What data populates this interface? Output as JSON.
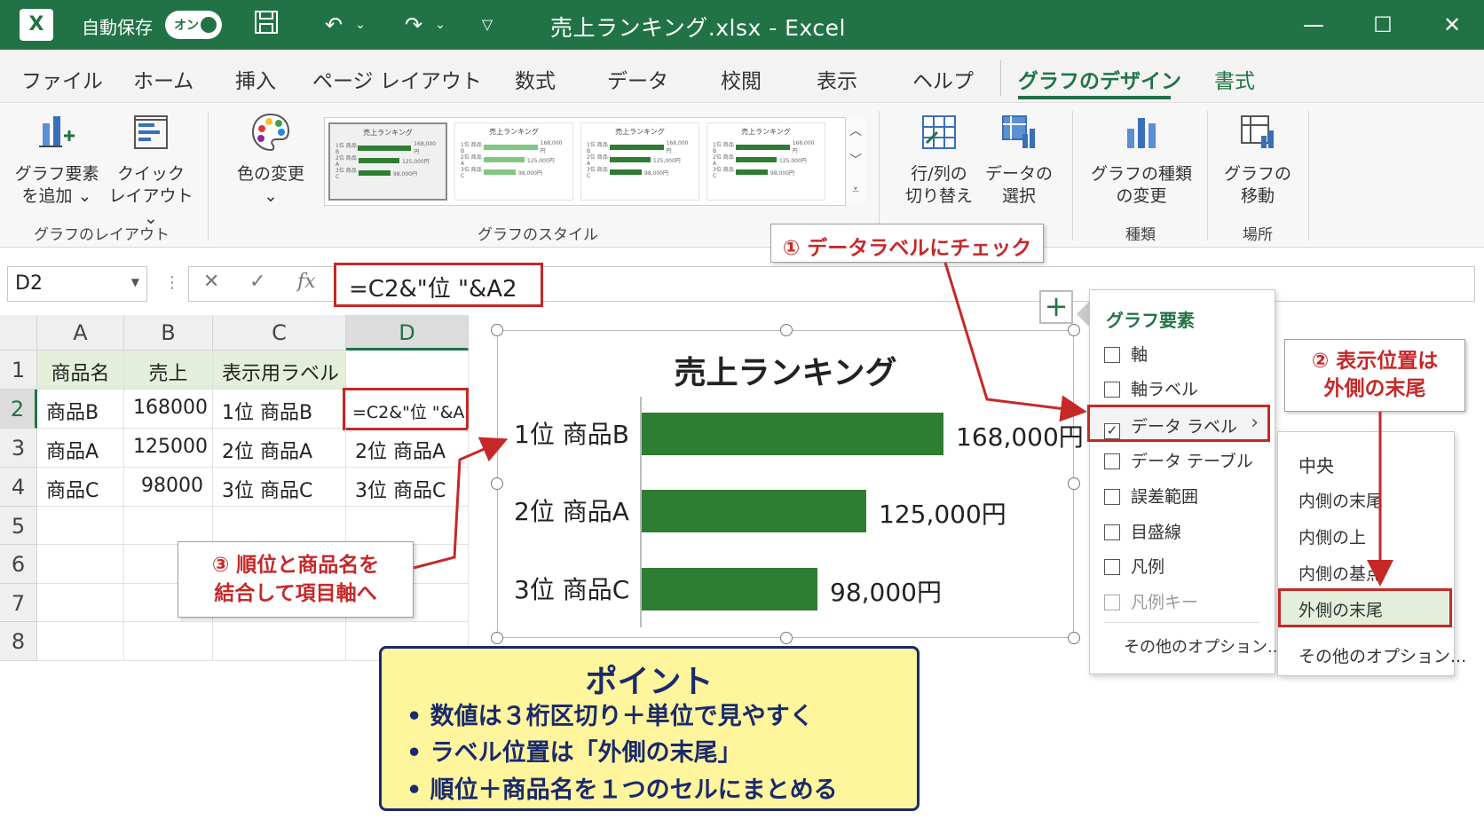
{
  "titlebar": {
    "app_icon": "excel-logo",
    "autosave_label": "自動保存",
    "toggle_label": "オン",
    "title": "売上ランキング.xlsx - Excel",
    "icons": [
      "save-icon",
      "undo-icon",
      "redo-icon",
      "customize-icon"
    ]
  },
  "tabs": [
    {
      "label": "ファイル"
    },
    {
      "label": "ホーム"
    },
    {
      "label": "挿入"
    },
    {
      "label": "ページ レイアウト"
    },
    {
      "label": "数式"
    },
    {
      "label": "データ"
    },
    {
      "label": "校閲"
    },
    {
      "label": "表示"
    },
    {
      "label": "ヘルプ"
    },
    {
      "label": "グラフのデザイン"
    },
    {
      "label": "書式"
    }
  ],
  "ribbon": {
    "add_element": {
      "line1": "グラフ要素",
      "line2": "を追加 ⌄"
    },
    "quick_layout": {
      "line1": "クイック",
      "line2": "レイアウト⌄"
    },
    "layout_group": "グラフのレイアウト",
    "color_change": {
      "line1": "色の変更",
      "line2": "⌄"
    },
    "style_group": "グラフのスタイル",
    "style_thumb_title": "売上ランキング",
    "switch_row_col": {
      "line1": "行/列の",
      "line2": "切り替え"
    },
    "select_data": {
      "line1": "データの",
      "line2": "選択"
    },
    "change_type": {
      "line1": "グラフの種類",
      "line2": "の変更"
    },
    "type_group": "種類",
    "move_chart": {
      "line1": "グラフの",
      "line2": "移動"
    },
    "location_group": "場所"
  },
  "formula_bar": {
    "name_box": "D2",
    "cancel": "✕",
    "enter": "✓",
    "fx": "fx",
    "formula": "=C2&\"位 \"&A2"
  },
  "sheet": {
    "columns": [
      "A",
      "B",
      "C",
      "D"
    ],
    "rows": [
      "1",
      "2",
      "3",
      "4",
      "5",
      "6",
      "7",
      "8"
    ],
    "header_row": [
      "商品名",
      "売上",
      "表示用ラベル",
      ""
    ],
    "data": [
      [
        "商品B",
        "168000",
        "1位 商品B",
        "=C2&\"位 \"&A2"
      ],
      [
        "商品A",
        "125000",
        "2位 商品A",
        "2位 商品A"
      ],
      [
        "商品C",
        "98000",
        "3位 商品C",
        "3位 商品C"
      ]
    ]
  },
  "chart_data": {
    "type": "bar",
    "title": "売上ランキング",
    "categories": [
      "1位 商品B",
      "2位 商品A",
      "3位 商品C"
    ],
    "values": [
      168000,
      125000,
      98000
    ],
    "value_labels": [
      "168,000円",
      "125,000円",
      "98,000円"
    ],
    "color": "#2e7d32",
    "xlim": [
      0,
      168000
    ],
    "label_position": "outside-end",
    "grid": false
  },
  "chart_elements": {
    "title": "グラフ要素",
    "items": [
      {
        "label": "軸",
        "checked": false
      },
      {
        "label": "軸ラベル",
        "checked": false
      },
      {
        "label": "データ ラベル",
        "checked": true
      },
      {
        "label": "データ テーブル",
        "checked": false
      },
      {
        "label": "誤差範囲",
        "checked": false
      },
      {
        "label": "目盛線",
        "checked": false
      },
      {
        "label": "凡例",
        "checked": false
      },
      {
        "label": "凡例キー",
        "checked": false
      }
    ],
    "more": "その他のオプション..."
  },
  "submenu": {
    "items": [
      "中央",
      "内側の末尾",
      "内側の上",
      "内側の基点",
      "外側の末尾"
    ],
    "more": "その他のオプション..."
  },
  "callouts": {
    "c1": "① データラベルにチェック",
    "c2_line1": "② 表示位置は",
    "c2_line2": "外側の末尾",
    "c3_line1": "③ 順位と商品名を",
    "c3_line2": "結合して項目軸へ"
  },
  "point": {
    "title": "ポイント",
    "lines": [
      "• 数値は３桁区切り＋単位で見やすく",
      "• ラベル位置は「外側の末尾」",
      "• 順位＋商品名を１つのセルにまとめる"
    ]
  },
  "colors": {
    "excel_green": "#217346",
    "bar": "#2e7d32",
    "highlight_red": "#c62828",
    "point_bg": "#fff59d",
    "point_text": "#1a2a6c"
  }
}
